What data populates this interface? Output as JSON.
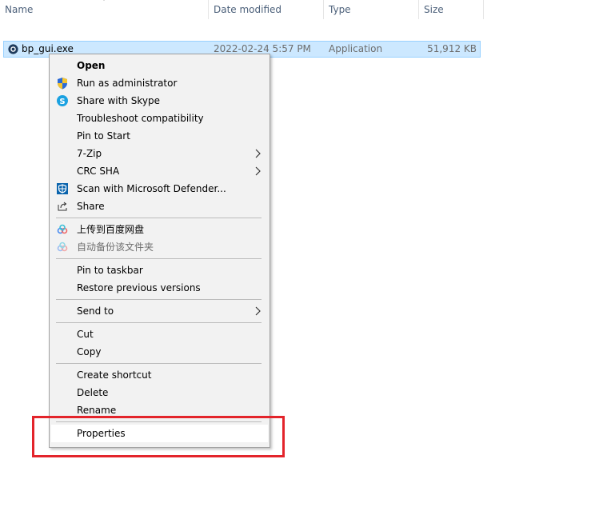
{
  "columns": {
    "name": "Name",
    "date_modified": "Date modified",
    "type": "Type",
    "size": "Size"
  },
  "file": {
    "name": "bp_gui.exe",
    "date_modified": "2022-02-24 5:57 PM",
    "type": "Application",
    "size": "51,912 KB",
    "icon": "app-icon"
  },
  "menu": {
    "open": "Open",
    "run_as_admin": "Run as administrator",
    "share_skype": "Share with Skype",
    "troubleshoot": "Troubleshoot compatibility",
    "pin_start": "Pin to Start",
    "seven_zip": "7-Zip",
    "crc_sha": "CRC SHA",
    "scan_defender": "Scan with Microsoft Defender...",
    "share": "Share",
    "baidu_upload": "上传到百度网盘",
    "baidu_backup": "自动备份该文件夹",
    "pin_taskbar": "Pin to taskbar",
    "restore_versions": "Restore previous versions",
    "send_to": "Send to",
    "cut": "Cut",
    "copy": "Copy",
    "create_shortcut": "Create shortcut",
    "delete": "Delete",
    "rename": "Rename",
    "properties": "Properties"
  },
  "colors": {
    "selection": "#cce8ff",
    "highlight_box": "#e3242b",
    "header_text": "#4c607a"
  }
}
